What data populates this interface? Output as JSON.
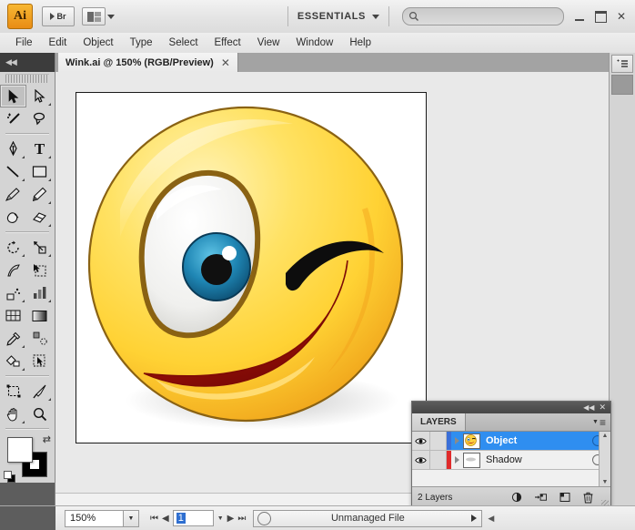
{
  "app": {
    "name": "Adobe Illustrator",
    "logo_text": "Ai",
    "bridge_label": "Br",
    "workspace": "ESSENTIALS",
    "search_placeholder": ""
  },
  "window_controls": {
    "minimize": "minimize-button",
    "maximize": "maximize-button",
    "close": "✕"
  },
  "menu": {
    "items": [
      {
        "label": "File"
      },
      {
        "label": "Edit"
      },
      {
        "label": "Object"
      },
      {
        "label": "Type"
      },
      {
        "label": "Select"
      },
      {
        "label": "Effect"
      },
      {
        "label": "View"
      },
      {
        "label": "Window"
      },
      {
        "label": "Help"
      }
    ]
  },
  "tabbar": {
    "collapse_glyph": "◀◀",
    "document_tab": "Wink.ai  @ 150% (RGB/Preview)",
    "close_glyph": "✕"
  },
  "toolbar": {
    "collapse_glyph": "◀◀",
    "tools": [
      {
        "name": "selection-tool",
        "glyph": "selection",
        "active": true,
        "hasmore": false
      },
      {
        "name": "direct-selection-tool",
        "glyph": "direct-selection",
        "active": false,
        "hasmore": true
      },
      {
        "name": "magic-wand-tool",
        "glyph": "magic-wand",
        "active": false,
        "hasmore": false
      },
      {
        "name": "lasso-tool",
        "glyph": "lasso",
        "active": false,
        "hasmore": false
      },
      {
        "name": "pen-tool",
        "glyph": "pen",
        "active": false,
        "hasmore": true
      },
      {
        "name": "type-tool",
        "glyph": "type",
        "active": false,
        "hasmore": true
      },
      {
        "name": "line-segment-tool",
        "glyph": "line",
        "active": false,
        "hasmore": true
      },
      {
        "name": "rectangle-tool",
        "glyph": "rectangle",
        "active": false,
        "hasmore": true
      },
      {
        "name": "paintbrush-tool",
        "glyph": "paintbrush",
        "active": false,
        "hasmore": false
      },
      {
        "name": "pencil-tool",
        "glyph": "pencil",
        "active": false,
        "hasmore": true
      },
      {
        "name": "blob-brush-tool",
        "glyph": "blob-brush",
        "active": false,
        "hasmore": false
      },
      {
        "name": "eraser-tool",
        "glyph": "eraser",
        "active": false,
        "hasmore": true
      },
      {
        "name": "rotate-tool",
        "glyph": "rotate",
        "active": false,
        "hasmore": true
      },
      {
        "name": "scale-tool",
        "glyph": "scale",
        "active": false,
        "hasmore": true
      },
      {
        "name": "width-tool",
        "glyph": "width",
        "active": false,
        "hasmore": true
      },
      {
        "name": "free-transform-tool",
        "glyph": "free-transform",
        "active": false,
        "hasmore": false
      },
      {
        "name": "symbol-sprayer-tool",
        "glyph": "symbol-sprayer",
        "active": false,
        "hasmore": true
      },
      {
        "name": "column-graph-tool",
        "glyph": "column-graph",
        "active": false,
        "hasmore": true
      },
      {
        "name": "mesh-tool",
        "glyph": "mesh",
        "active": false,
        "hasmore": false
      },
      {
        "name": "gradient-tool",
        "glyph": "gradient",
        "active": false,
        "hasmore": false
      },
      {
        "name": "eyedropper-tool",
        "glyph": "eyedropper",
        "active": false,
        "hasmore": true
      },
      {
        "name": "blend-tool",
        "glyph": "blend",
        "active": false,
        "hasmore": false
      },
      {
        "name": "live-paint-bucket-tool",
        "glyph": "live-paint",
        "active": false,
        "hasmore": true
      },
      {
        "name": "live-paint-selection-tool",
        "glyph": "live-paint-select",
        "active": false,
        "hasmore": false
      },
      {
        "name": "artboard-tool",
        "glyph": "artboard",
        "active": false,
        "hasmore": false
      },
      {
        "name": "slice-tool",
        "glyph": "slice",
        "active": false,
        "hasmore": true
      },
      {
        "name": "hand-tool",
        "glyph": "hand",
        "active": false,
        "hasmore": true
      },
      {
        "name": "zoom-tool",
        "glyph": "zoom",
        "active": false,
        "hasmore": false
      }
    ],
    "fill_color": "#ffffff",
    "stroke_color": "#000000",
    "swap_glyph": "⇄",
    "mode_buttons": [
      {
        "name": "color-mode-button",
        "selected": true
      },
      {
        "name": "gradient-mode-button",
        "selected": false
      },
      {
        "name": "none-mode-button",
        "selected": false
      }
    ]
  },
  "canvas": {
    "artboard_background": "#ffffff",
    "artwork_name": "winking-smiley-face",
    "colors": {
      "face_light": "#fde89a",
      "face_mid": "#ffd23f",
      "face_deep": "#f5a623",
      "outline": "#8a6213",
      "eye_white": "#f2f2f0",
      "iris": "#1b7fa8",
      "pupil": "#111111",
      "mouth": "#a81010",
      "mouth_dark": "#8c0a0a"
    }
  },
  "layers_panel": {
    "title": "LAYERS",
    "collapse_glyph": "◀◀",
    "close_glyph": "✕",
    "menu_glyph": "≡",
    "rows": [
      {
        "name": "Object",
        "color": "#3a6fd8",
        "selected": true,
        "visible": true,
        "locked": false,
        "thumbnail": "smiley-thumbnail"
      },
      {
        "name": "Shadow",
        "color": "#e02b2b",
        "selected": false,
        "visible": true,
        "locked": false,
        "thumbnail": "shadow-thumbnail"
      }
    ],
    "footer_count": "2 Layers",
    "footer_buttons": [
      {
        "name": "make-clipping-mask-button"
      },
      {
        "name": "create-new-sublayer-button"
      },
      {
        "name": "create-new-layer-button"
      },
      {
        "name": "delete-selection-button"
      }
    ]
  },
  "statusbar": {
    "zoom_value": "150%",
    "zoom_dropdown_glyph": "▼",
    "nav_first": "⏮",
    "nav_prev": "◀",
    "page_value": "1",
    "page_dropdown_glyph": "▼",
    "nav_next": "▶",
    "nav_last": "⏭",
    "status_text": "Unmanaged File",
    "status_arrow": "▶"
  }
}
